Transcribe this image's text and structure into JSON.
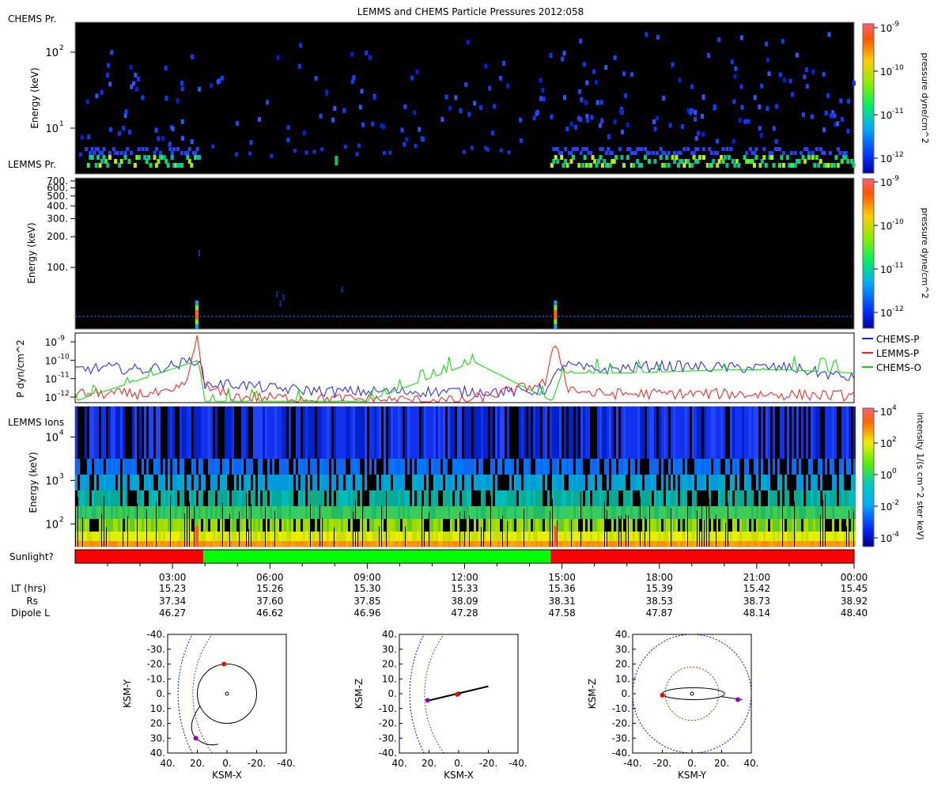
{
  "title": "LEMMS and CHEMS Particle Pressures  2012:058",
  "colors": {
    "panel_bg": "#000000",
    "sun_on": "#00ff00",
    "sun_off": "#ff0000",
    "chems_p": "#1f1fff",
    "lemms_p": "#ff1a1a",
    "chems_o": "#00dd00",
    "orbit": "#000000",
    "magnetopause": "#0000ff",
    "bowshock_inner": "#8b3a1a"
  },
  "panel1": {
    "side_label_top": "CHEMS Pr.",
    "side_label_bottom": "LEMMS Pr.",
    "ylabel": "Energy (keV)",
    "yticks": [
      {
        "label": "10"
      },
      {
        "label": "10"
      }
    ],
    "ytick_exps": [
      "2",
      "1"
    ],
    "colorbar": {
      "label": "pressure dyne/cm^2",
      "ticks": [
        {
          "label": "10",
          "exp": "-9"
        },
        {
          "label": "10",
          "exp": "-10"
        },
        {
          "label": "10",
          "exp": "-11"
        },
        {
          "label": "10",
          "exp": "-12"
        }
      ]
    }
  },
  "panel2": {
    "ylabel": "Energy (keV)",
    "yticks": [
      {
        "label": "700."
      },
      {
        "label": "600."
      },
      {
        "label": "500."
      },
      {
        "label": "400."
      },
      {
        "label": "300."
      },
      {
        "label": "200."
      },
      {
        "label": "100."
      }
    ],
    "colorbar": {
      "label": "pressure dyne/cm^2",
      "ticks": [
        {
          "label": "10",
          "exp": "-9"
        },
        {
          "label": "10",
          "exp": "-10"
        },
        {
          "label": "10",
          "exp": "-11"
        },
        {
          "label": "10",
          "exp": "-12"
        }
      ]
    }
  },
  "panel3": {
    "ylabel": "P dyn/cm^2",
    "yticks": [
      {
        "label": "10",
        "exp": "-9"
      },
      {
        "label": "10",
        "exp": "-10"
      },
      {
        "label": "10",
        "exp": "-11"
      },
      {
        "label": "10",
        "exp": "-12"
      }
    ],
    "legend": [
      "CHEMS-P",
      "LEMMS-P",
      "CHEMS-O"
    ]
  },
  "panel4": {
    "side_label": "LEMMS Ions",
    "ylabel": "Energy (keV)",
    "yticks": [
      {
        "label": "10",
        "exp": "4"
      },
      {
        "label": "10",
        "exp": "3"
      },
      {
        "label": "10",
        "exp": "2"
      }
    ],
    "colorbar": {
      "label": "intensity 1/(s cm^2 ster keV)",
      "ticks": [
        {
          "label": "10",
          "exp": "4"
        },
        {
          "label": "10",
          "exp": "2"
        },
        {
          "label": "10",
          "exp": "0"
        },
        {
          "label": "10",
          "exp": "-2"
        },
        {
          "label": "10",
          "exp": "-4"
        }
      ]
    }
  },
  "sunlight": {
    "label": "Sunlight?",
    "segments": [
      {
        "start_hr": 0.0,
        "end_hr": 3.95,
        "state": "no"
      },
      {
        "start_hr": 3.95,
        "end_hr": 14.65,
        "state": "yes"
      },
      {
        "start_hr": 14.65,
        "end_hr": 24.0,
        "state": "no"
      }
    ]
  },
  "xaxis": {
    "time_ticks": [
      "03:00",
      "06:00",
      "09:00",
      "12:00",
      "15:00",
      "18:00",
      "21:00",
      "00:00"
    ],
    "row_labels": [
      "LT (hrs)",
      "Rs",
      "Dipole L"
    ],
    "lt": [
      "15.23",
      "15.26",
      "15.30",
      "15.33",
      "15.36",
      "15.39",
      "15.42",
      "15.45"
    ],
    "rs": [
      "37.34",
      "37.60",
      "37.85",
      "38.09",
      "38.31",
      "38.53",
      "38.73",
      "38.92"
    ],
    "dipole_l": [
      "46.27",
      "46.62",
      "46.96",
      "47.28",
      "47.58",
      "47.87",
      "48.14",
      "48.40"
    ]
  },
  "orbits": [
    {
      "name": "xy",
      "xlabel": "KSM-X",
      "ylabel": "KSM-Y",
      "xticks": [
        "40.",
        "20.",
        "0.",
        "-20.",
        "-40."
      ],
      "yticks": [
        "-40.",
        "-30.",
        "-20.",
        "-10.",
        "0.",
        "10.",
        "20.",
        "30.",
        "40."
      ]
    },
    {
      "name": "xz",
      "xlabel": "KSM-X",
      "ylabel": "KSM-Z",
      "xticks": [
        "40.",
        "20.",
        "0.",
        "-20.",
        "-40."
      ],
      "yticks": [
        "40.",
        "30.",
        "20.",
        "10.",
        "0.",
        "-10.",
        "-20.",
        "-30.",
        "-40."
      ]
    },
    {
      "name": "yz",
      "xlabel": "KSM-Y",
      "ylabel": "KSM-Z",
      "xticks": [
        "-40.",
        "-20.",
        "0.",
        "20.",
        "40."
      ],
      "yticks": [
        "40.",
        "30.",
        "20.",
        "10.",
        "0.",
        "-10.",
        "-20.",
        "-30.",
        "-40."
      ]
    }
  ],
  "chart_data": [
    {
      "type": "heatmap",
      "title": "LEMMS and CHEMS Particle Pressures  2012:058",
      "ylabel": "Energy (keV)",
      "y_scale": "log",
      "ylim": [
        3,
        300
      ],
      "x_range_hours": [
        0,
        24
      ],
      "colorbar_label": "pressure dyne/cm^2",
      "colorbar_range": [
        1e-12,
        1e-09
      ],
      "series": [
        {
          "name": "CHEMS Pr.",
          "note_level": "1e-12 to 1e-11 scattered points, denser below 10 keV"
        },
        {
          "name": "LEMMS Pr.",
          "active_intervals_hours": [
            [
              0.25,
              3.8
            ],
            [
              14.6,
              24.0
            ]
          ],
          "level_range": [
            1e-11,
            3e-11
          ]
        }
      ]
    },
    {
      "type": "heatmap",
      "ylabel": "Energy (keV)",
      "y_scale": "log",
      "ylim": [
        25,
        750
      ],
      "colorbar_label": "pressure dyne/cm^2",
      "colorbar_range": [
        1e-12,
        1e-09
      ],
      "spikes_hours": [
        3.75,
        14.8
      ],
      "spike_peak": 1e-09
    },
    {
      "type": "line",
      "ylabel": "P dyn/cm^2",
      "y_scale": "log",
      "ylim": [
        5e-13,
        3e-09
      ],
      "x_range_hours": [
        0,
        24
      ],
      "series": [
        {
          "name": "CHEMS-P",
          "x_hours": [
            0,
            1,
            2,
            3,
            3.8,
            4,
            5,
            6,
            8,
            10,
            12,
            14,
            14.6,
            15,
            16,
            18,
            20,
            22,
            24
          ],
          "values": [
            3e-11,
            4e-11,
            3e-11,
            5e-11,
            1.2e-10,
            5e-12,
            5e-12,
            3e-12,
            2e-12,
            2e-12,
            2e-12,
            2e-12,
            3e-12,
            6e-11,
            3e-11,
            5e-11,
            4e-11,
            4e-11,
            1e-11
          ]
        },
        {
          "name": "LEMMS-P",
          "x_hours": [
            0,
            1,
            2,
            3,
            3.5,
            3.75,
            4,
            5,
            8,
            12,
            14.5,
            14.8,
            15.2,
            16,
            20,
            24
          ],
          "values": [
            1.5e-12,
            1.5e-12,
            1.5e-12,
            1.5e-12,
            1e-11,
            2.5e-09,
            3e-12,
            1e-12,
            8e-13,
            6e-13,
            6e-12,
            1e-09,
            3e-12,
            1.5e-12,
            1.5e-12,
            1.2e-12
          ]
        },
        {
          "name": "CHEMS-O",
          "x_hours": [
            0,
            3.8,
            4,
            9,
            12.3,
            14.7,
            15,
            17,
            20,
            22,
            24
          ],
          "values": [
            6e-13,
            1e-10,
            6e-13,
            6e-13,
            8e-11,
            6e-13,
            2e-11,
            2e-11,
            3e-11,
            3e-11,
            2e-11
          ]
        }
      ]
    },
    {
      "type": "heatmap",
      "ylabel": "Energy (keV)",
      "y_scale": "log",
      "ylim": [
        30,
        50000
      ],
      "colorbar_label": "intensity 1/(s cm^2 ster keV)",
      "colorbar_range": [
        1e-05,
        10000.0
      ]
    },
    {
      "type": "scatter",
      "xlabel": "KSM-X",
      "ylabel": "KSM-Y",
      "xlim": [
        40,
        -40
      ],
      "ylim": [
        -40,
        40
      ],
      "orbit_x": [
        0,
        18,
        18,
        0,
        -18,
        -18,
        0,
        0,
        5,
        12,
        20,
        21.5,
        20,
        14,
        4,
        -2
      ],
      "orbit_y": [
        0,
        -10,
        10,
        20,
        10,
        -10,
        -20,
        0,
        20,
        26,
        31,
        28,
        24,
        22,
        28,
        35
      ],
      "markers": [
        {
          "x": 2,
          "y": -20,
          "color": "red"
        },
        {
          "x": 21,
          "y": 30,
          "color": "purple"
        }
      ]
    },
    {
      "type": "scatter",
      "xlabel": "KSM-X",
      "ylabel": "KSM-Z",
      "xlim": [
        40,
        -40
      ],
      "ylim": [
        -40,
        40
      ],
      "orbit_x": [
        22,
        0,
        -20
      ],
      "orbit_z": [
        -5,
        -0.5,
        5
      ],
      "markers": [
        {
          "x": 1,
          "y": -0.5,
          "color": "red"
        },
        {
          "x": 21,
          "y": -4.5,
          "color": "purple"
        }
      ]
    },
    {
      "type": "scatter",
      "xlabel": "KSM-Y",
      "ylabel": "KSM-Z",
      "xlim": [
        -40,
        40
      ],
      "ylim": [
        40,
        -40
      ],
      "orbit_y": [
        -20,
        0,
        22,
        34
      ],
      "orbit_z": [
        0,
        -4,
        0,
        4
      ],
      "markers": [
        {
          "x": -20,
          "y": -1,
          "color": "red"
        },
        {
          "x": 31,
          "y": -4,
          "color": "purple"
        }
      ]
    }
  ]
}
